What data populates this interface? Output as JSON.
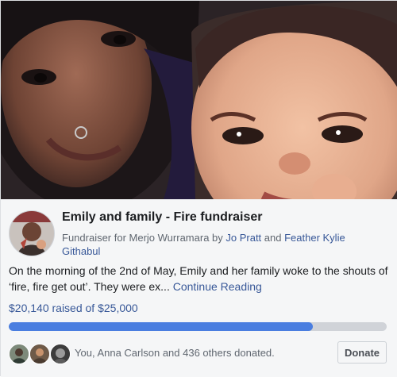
{
  "fundraiser": {
    "title": "Emily and family - Fire fundraiser",
    "subtitle": {
      "prefix": "Fundraiser for Merjo Wurramara by ",
      "organizer_1": "Jo Pratt",
      "conjunction": " and ",
      "organizer_2": "Feather Kylie Githabul"
    },
    "description": "On the morning of the 2nd of May, Emily and her family woke to the shouts of ‘fire, fire get out’. They were ex... ",
    "continue_reading": "Continue Reading",
    "raised_text": "$20,140 raised of $25,000",
    "raised_amount": 20140,
    "goal_amount": 25000,
    "progress_fraction": 0.8056
  },
  "donations": {
    "summary": "You, Anna Carlson and 436 others donated.",
    "donate_label": "Donate"
  },
  "icons": {
    "cover": "cover-photo",
    "avatar": "fundraiser-avatar",
    "donors": [
      "donor-avatar-1",
      "donor-avatar-2",
      "donor-avatar-3"
    ]
  },
  "colors": {
    "link": "#385898",
    "progress_fill": "#4a7ee0",
    "progress_track": "#d0d3d8",
    "content_bg": "#f5f6f7"
  }
}
